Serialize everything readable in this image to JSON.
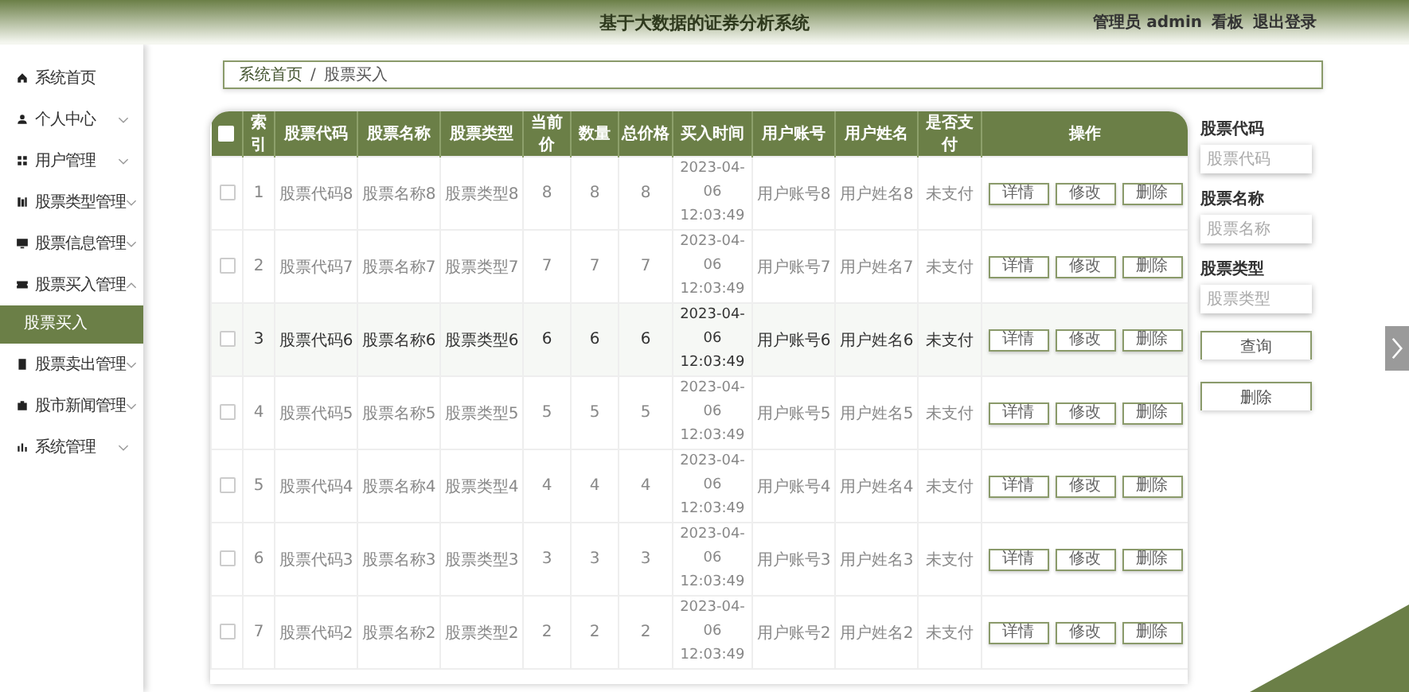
{
  "header": {
    "title": "基于大数据的证券分析系统",
    "user": "管理员 admin",
    "links": [
      "看板",
      "退出登录"
    ]
  },
  "sidebar": {
    "items": [
      {
        "label": "系统首页",
        "kind": "link"
      },
      {
        "label": "个人中心",
        "kind": "group",
        "expanded": false
      },
      {
        "label": "用户管理",
        "kind": "group",
        "expanded": false
      },
      {
        "label": "股票类型管理",
        "kind": "group",
        "expanded": false
      },
      {
        "label": "股票信息管理",
        "kind": "group",
        "expanded": false
      },
      {
        "label": "股票买入管理",
        "kind": "group",
        "expanded": true,
        "children": [
          {
            "label": "股票买入",
            "selected": true
          }
        ]
      },
      {
        "label": "股票卖出管理",
        "kind": "group",
        "expanded": false
      },
      {
        "label": "股市新闻管理",
        "kind": "group",
        "expanded": false
      },
      {
        "label": "系统管理",
        "kind": "group",
        "expanded": false
      }
    ]
  },
  "breadcrumb": [
    "系统首页",
    "/",
    "股票买入"
  ],
  "table": {
    "select_all": false,
    "columns": [
      "索引",
      "股票代码",
      "股票名称",
      "股票类型",
      "当前价",
      "数量",
      "总价格",
      "买入时间",
      "用户账号",
      "用户姓名",
      "是否支付",
      "操作"
    ],
    "rows": [
      {
        "checked": false,
        "hovered": false,
        "cells": [
          "1",
          "股票代码8",
          "股票名称8",
          "股票类型8",
          "8",
          "8",
          "8",
          "2023-04-06 12:03:49",
          "用户账号8",
          "用户姓名8",
          "未支付"
        ],
        "actions": [
          "详情",
          "修改",
          "删除"
        ]
      },
      {
        "checked": false,
        "hovered": false,
        "cells": [
          "2",
          "股票代码7",
          "股票名称7",
          "股票类型7",
          "7",
          "7",
          "7",
          "2023-04-06 12:03:49",
          "用户账号7",
          "用户姓名7",
          "未支付"
        ],
        "actions": [
          "详情",
          "修改",
          "删除"
        ]
      },
      {
        "checked": false,
        "hovered": true,
        "cells": [
          "3",
          "股票代码6",
          "股票名称6",
          "股票类型6",
          "6",
          "6",
          "6",
          "2023-04-06 12:03:49",
          "用户账号6",
          "用户姓名6",
          "未支付"
        ],
        "actions": [
          "详情",
          "修改",
          "删除"
        ]
      },
      {
        "checked": false,
        "hovered": false,
        "cells": [
          "4",
          "股票代码5",
          "股票名称5",
          "股票类型5",
          "5",
          "5",
          "5",
          "2023-04-06 12:03:49",
          "用户账号5",
          "用户姓名5",
          "未支付"
        ],
        "actions": [
          "详情",
          "修改",
          "删除"
        ]
      },
      {
        "checked": false,
        "hovered": false,
        "cells": [
          "5",
          "股票代码4",
          "股票名称4",
          "股票类型4",
          "4",
          "4",
          "4",
          "2023-04-06 12:03:49",
          "用户账号4",
          "用户姓名4",
          "未支付"
        ],
        "actions": [
          "详情",
          "修改",
          "删除"
        ]
      },
      {
        "checked": false,
        "hovered": false,
        "cells": [
          "6",
          "股票代码3",
          "股票名称3",
          "股票类型3",
          "3",
          "3",
          "3",
          "2023-04-06 12:03:49",
          "用户账号3",
          "用户姓名3",
          "未支付"
        ],
        "actions": [
          "详情",
          "修改",
          "删除"
        ]
      },
      {
        "checked": false,
        "hovered": false,
        "cells": [
          "7",
          "股票代码2",
          "股票名称2",
          "股票类型2",
          "2",
          "2",
          "2",
          "2023-04-06 12:03:49",
          "用户账号2",
          "用户姓名2",
          "未支付"
        ],
        "actions": [
          "详情",
          "修改",
          "删除"
        ]
      }
    ]
  },
  "search": {
    "fields": [
      {
        "label": "股票代码",
        "placeholder": "股票代码"
      },
      {
        "label": "股票名称",
        "placeholder": "股票名称"
      },
      {
        "label": "股票类型",
        "placeholder": "股票类型"
      }
    ],
    "buttons": [
      "查询",
      "删除"
    ]
  }
}
